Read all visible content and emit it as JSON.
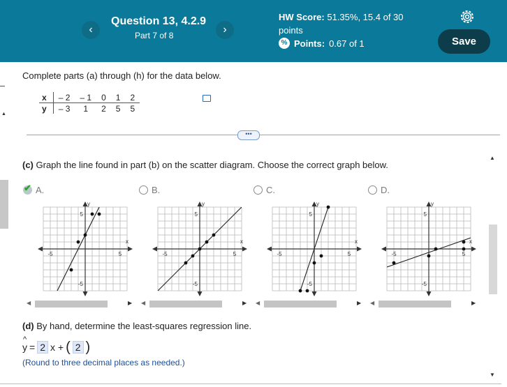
{
  "header": {
    "title": "Question 13, 4.2.9",
    "part": "Part 7 of 8",
    "prev_label": "‹",
    "next_label": "›",
    "hw_score_label": "HW Score:",
    "hw_score_value": "51.35%, 15.4 of 30",
    "hw_score_unit": "points",
    "points_label": "Points:",
    "points_value": "0.67 of 1",
    "save_label": "Save"
  },
  "problem": {
    "intro": "Complete parts (a) through (h) for the data below.",
    "table": {
      "x_label": "x",
      "y_label": "y",
      "x": [
        "– 2",
        "– 1",
        "0",
        "1",
        "2"
      ],
      "y": [
        "– 3",
        "1",
        "2",
        "5",
        "5"
      ]
    },
    "more_label": "•••"
  },
  "part_c": {
    "prompt": "(c) Graph the line found in part (b) on the scatter diagram. Choose the correct graph below.",
    "options": [
      {
        "label": "A.",
        "selected": true,
        "correct": true
      },
      {
        "label": "B.",
        "selected": false
      },
      {
        "label": "C.",
        "selected": false
      },
      {
        "label": "D.",
        "selected": false
      }
    ],
    "axis": {
      "x_label": "x",
      "y_label": "y",
      "tick_pos": "5",
      "tick_neg": "-5"
    }
  },
  "chart_data": [
    {
      "type": "scatter",
      "option": "A",
      "xlim": [
        -6,
        6
      ],
      "ylim": [
        -6,
        6
      ],
      "points": [
        [
          -2,
          -3
        ],
        [
          -1,
          1
        ],
        [
          0,
          2
        ],
        [
          1,
          5
        ],
        [
          2,
          5
        ]
      ],
      "line": {
        "slope": 2,
        "intercept": 2
      }
    },
    {
      "type": "scatter",
      "option": "B",
      "xlim": [
        -6,
        6
      ],
      "ylim": [
        -6,
        6
      ],
      "points": [
        [
          -2,
          -2
        ],
        [
          -1,
          -1
        ],
        [
          0,
          0
        ],
        [
          1,
          1
        ],
        [
          2,
          2
        ]
      ],
      "line": {
        "slope": 1,
        "intercept": 0
      }
    },
    {
      "type": "scatter",
      "option": "C",
      "xlim": [
        -6,
        6
      ],
      "ylim": [
        -6,
        6
      ],
      "points": [
        [
          -2,
          -6
        ],
        [
          -1,
          -6
        ],
        [
          0,
          -2
        ],
        [
          1,
          -1
        ],
        [
          2,
          6
        ]
      ],
      "line": {
        "slope": 3,
        "intercept": 0
      }
    },
    {
      "type": "scatter",
      "option": "D",
      "xlim": [
        -6,
        6
      ],
      "ylim": [
        -6,
        6
      ],
      "points": [
        [
          -5,
          -2
        ],
        [
          0,
          -1
        ],
        [
          1,
          0
        ],
        [
          5,
          1
        ],
        [
          5,
          0
        ]
      ],
      "line": {
        "slope": 0.35,
        "intercept": -0.5
      }
    }
  ],
  "part_d": {
    "prompt": "(d) By hand, determine the least-squares regression line.",
    "yhat": "y",
    "equals": "=",
    "slope": "2",
    "x_plus": "x +",
    "intercept": "2",
    "note": "(Round to three decimal places as needed.)"
  },
  "colors": {
    "header": "#0b7a9a",
    "save": "#0d3d4a",
    "note": "#1d4f96"
  }
}
